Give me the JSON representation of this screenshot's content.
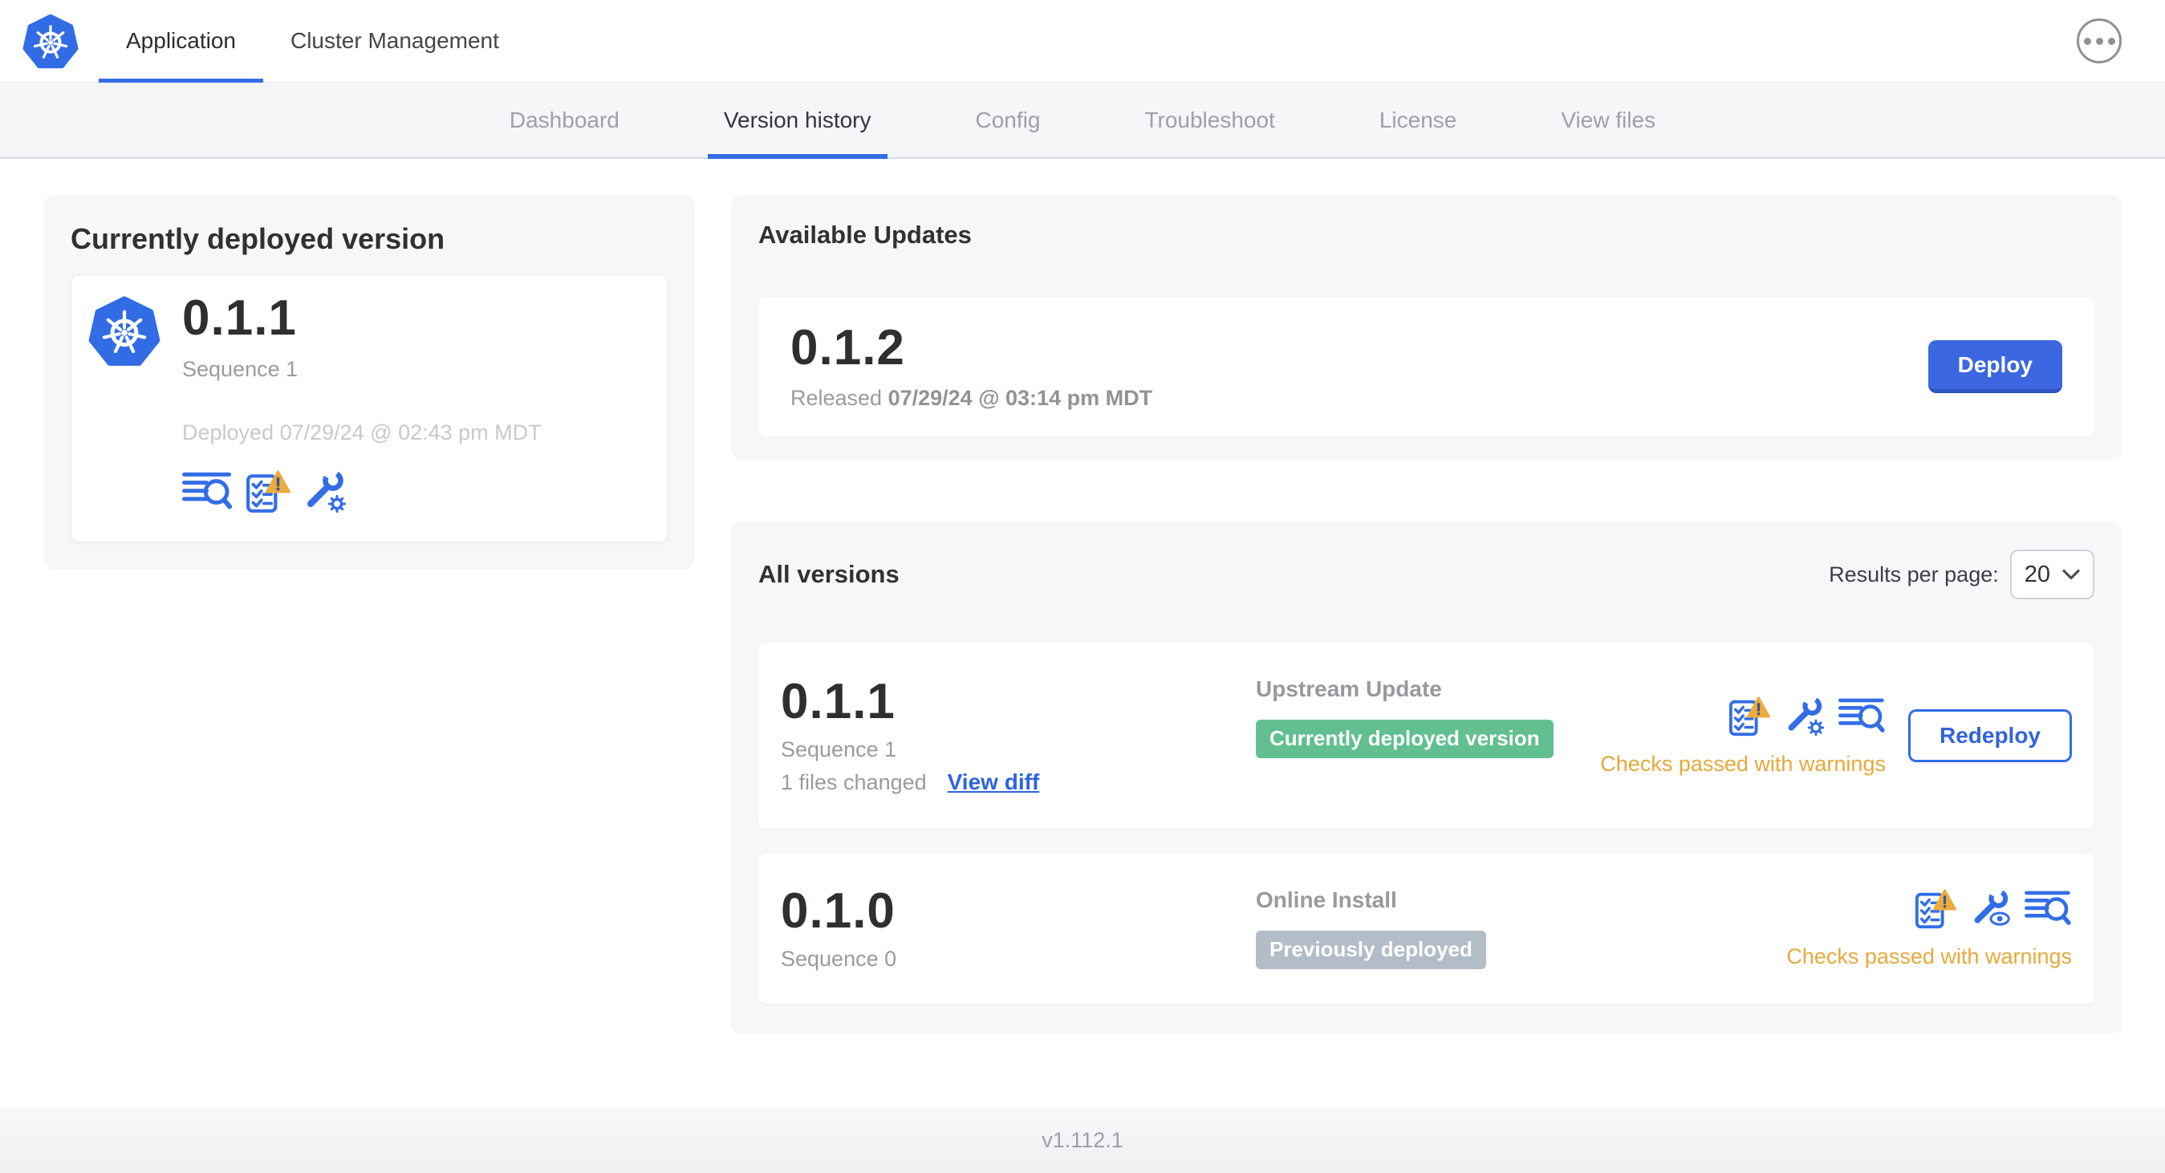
{
  "colors": {
    "accent_blue": "#326DE6",
    "green_badge": "#61BF90",
    "gray_badge": "#B3BDC7",
    "warning_orange": "#E7A93A"
  },
  "header": {
    "logo_icon": "kubernetes-logo",
    "menu_icon": "ellipsis-menu-icon",
    "tabs": [
      {
        "label": "Application",
        "active": true
      },
      {
        "label": "Cluster Management",
        "active": false
      }
    ]
  },
  "subnav": {
    "active_tab": "Version history",
    "tabs": [
      "Dashboard",
      "Version history",
      "Config",
      "Troubleshoot",
      "License",
      "View files"
    ]
  },
  "current_version": {
    "title": "Currently deployed version",
    "version": "0.1.1",
    "sequence": "Sequence 1",
    "deployed": "Deployed 07/29/24 @ 02:43 pm MDT",
    "icons": [
      "diff-icon",
      "preflight-warning-icon",
      "config-edit-icon"
    ]
  },
  "available_updates": {
    "title": "Available Updates",
    "version": "0.1.2",
    "released_label": "Released",
    "released_date": "07/29/24 @ 03:14 pm MDT",
    "deploy_button": "Deploy"
  },
  "all_versions": {
    "title": "All versions",
    "results_per_page_label": "Results per page:",
    "results_per_page_value": "20",
    "rows": [
      {
        "version": "0.1.1",
        "sequence": "Sequence 1",
        "files_changed": "1 files changed",
        "view_diff_link": "View diff",
        "source": "Upstream Update",
        "badge": "Currently deployed version",
        "status": "Checks passed with warnings",
        "action_button": "Redeploy",
        "icons": [
          "preflight-warning-icon",
          "config-edit-icon",
          "diff-icon"
        ]
      },
      {
        "version": "0.1.0",
        "sequence": "Sequence 0",
        "source": "Online Install",
        "badge": "Previously deployed",
        "status": "Checks passed with warnings",
        "icons": [
          "preflight-warning-icon",
          "config-view-icon",
          "diff-icon"
        ]
      }
    ]
  },
  "footer": {
    "app_version": "v1.112.1"
  }
}
